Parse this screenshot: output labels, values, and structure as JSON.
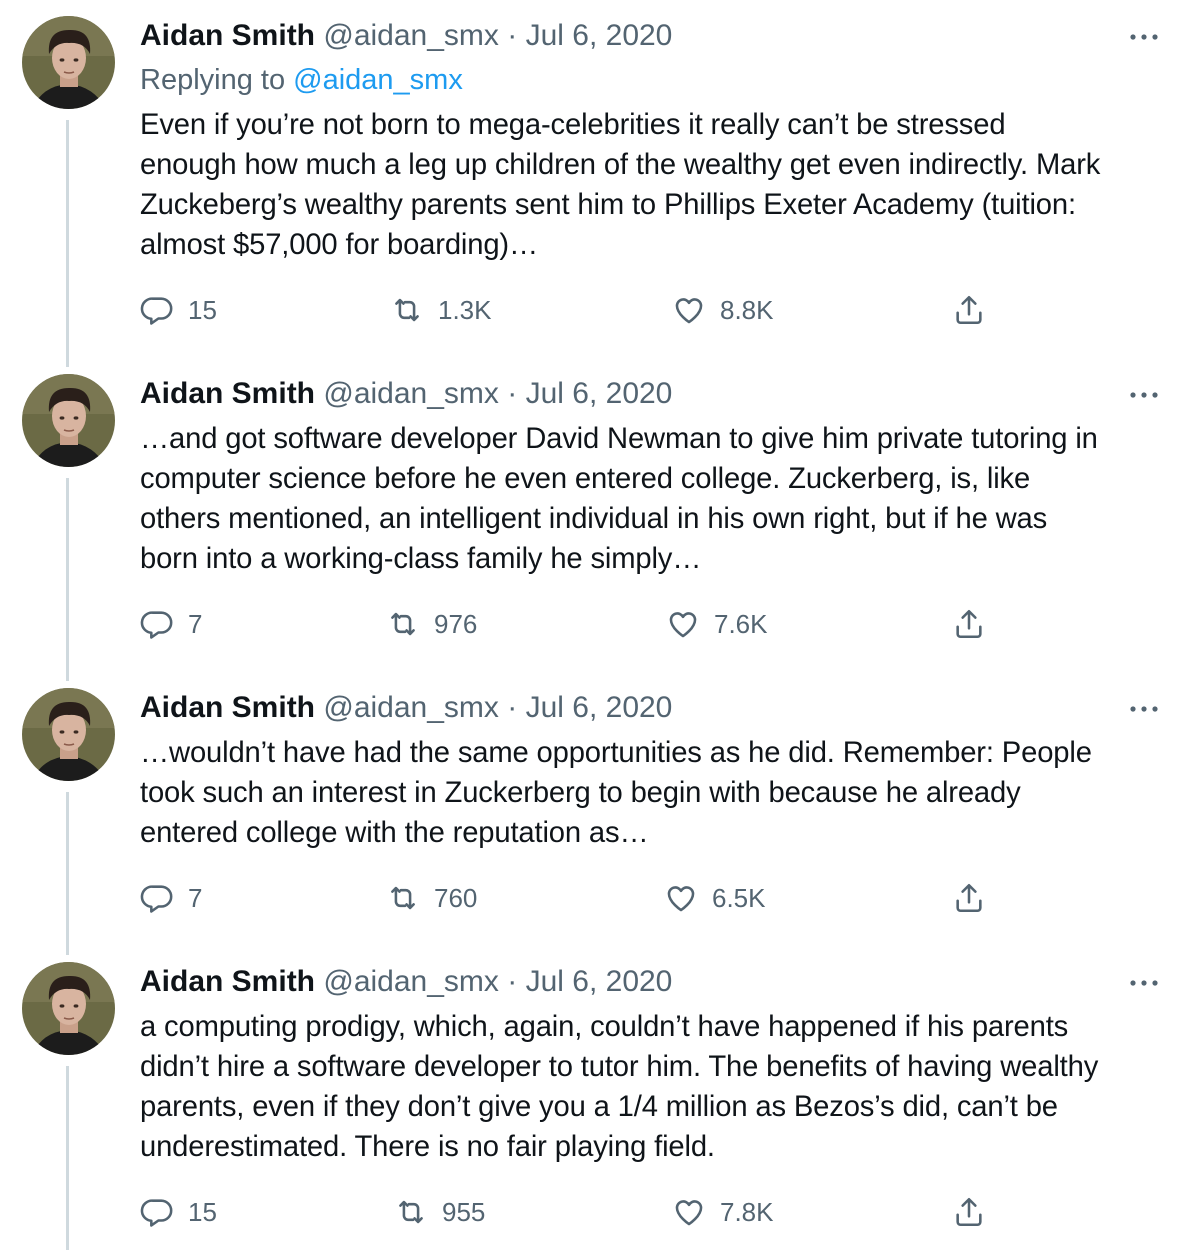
{
  "author": {
    "name": "Aidan Smith",
    "handle": "@aidan_smx"
  },
  "tweets": [
    {
      "name": "Aidan Smith",
      "handle": "@aidan_smx",
      "separator": "·",
      "date": "Jul 6, 2020",
      "replying_label": "Replying to",
      "replying_to": "@aidan_smx",
      "text": "Even if you’re not born to mega-celebrities it really can’t be stressed\nenough how much a leg up children of the wealthy get even indirectly. Mark\nZuckeberg’s wealthy parents sent him to Phillips Exeter Academy (tuition:\nalmost $57,000 for boarding)…",
      "replies": "15",
      "retweets": "1.3K",
      "likes": "8.8K"
    },
    {
      "name": "Aidan Smith",
      "handle": "@aidan_smx",
      "separator": "·",
      "date": "Jul 6, 2020",
      "text": "…and got software developer David Newman to give him private tutoring in\ncomputer science before he even entered college. Zuckerberg, is, like\nothers mentioned, an intelligent individual in his own right, but if he was\nborn into a working-class family he simply…",
      "replies": "7",
      "retweets": "976",
      "likes": "7.6K"
    },
    {
      "name": "Aidan Smith",
      "handle": "@aidan_smx",
      "separator": "·",
      "date": "Jul 6, 2020",
      "text": "…wouldn’t have had the same opportunities as he did. Remember: People\ntook such an interest in Zuckerberg to begin with because he already\nentered college with the reputation as…",
      "replies": "7",
      "retweets": "760",
      "likes": "6.5K"
    },
    {
      "name": "Aidan Smith",
      "handle": "@aidan_smx",
      "separator": "·",
      "date": "Jul 6, 2020",
      "text": "a computing prodigy, which, again, couldn’t have happened if his parents\ndidn’t hire a software developer to tutor him. The benefits of having wealthy\nparents, even if they don’t give you a 1/4 million as Bezos’s did, can’t be\nunderestimated. There is no fair playing field.",
      "replies": "15",
      "retweets": "955",
      "likes": "7.8K"
    }
  ],
  "icons": {
    "reply": "reply-icon",
    "retweet": "retweet-icon",
    "like": "heart-icon",
    "share": "share-icon",
    "more": "more-icon"
  },
  "colors": {
    "text": "#0f1419",
    "secondary": "#536471",
    "link": "#1d9bf0",
    "thread_line": "#cfd9de"
  }
}
